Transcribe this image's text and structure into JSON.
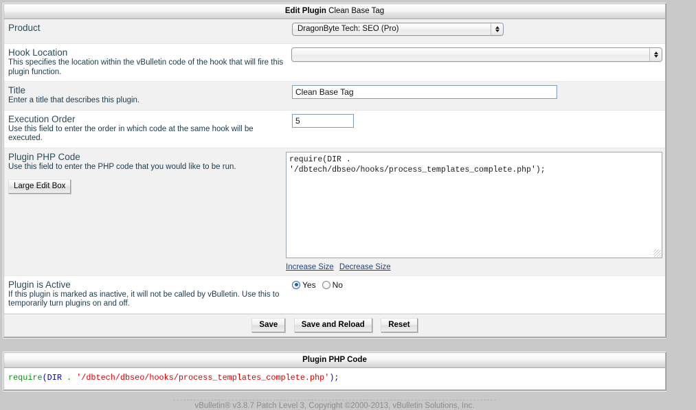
{
  "header": {
    "title_bold": "Edit Plugin",
    "title_sub": "Clean Base Tag"
  },
  "form": {
    "product": {
      "label": "Product",
      "value": "DragonByte Tech: SEO (Pro)"
    },
    "hook_location": {
      "label": "Hook Location",
      "description": "This specifies the location within the vBulletin code of the hook that will fire this plugin function.",
      "value": ""
    },
    "title": {
      "label": "Title",
      "description": "Enter a title that describes this plugin.",
      "value": "Clean Base Tag"
    },
    "execution_order": {
      "label": "Execution Order",
      "description": "Use this field to enter the order in which code at the same hook will be executed.",
      "value": "5"
    },
    "plugin_php_code": {
      "label": "Plugin PHP Code",
      "description": "Use this field to enter the PHP code that you would like to be run.",
      "large_edit_box_button": "Large Edit Box",
      "value": "require(DIR .\n'/dbtech/dbseo/hooks/process_templates_complete.php');",
      "increase_size_link": "Increase Size",
      "decrease_size_link": "Decrease Size"
    },
    "plugin_is_active": {
      "label": "Plugin is Active",
      "description": "If this plugin is marked as inactive, it will not be called by vBulletin. Use this to temporarily turn plugins on and off.",
      "yes_label": "Yes",
      "no_label": "No",
      "selected": "Yes"
    }
  },
  "buttons": {
    "save": "Save",
    "save_and_reload": "Save and Reload",
    "reset": "Reset"
  },
  "code_panel": {
    "title": "Plugin PHP Code",
    "tokens": [
      {
        "text": "require",
        "type": "kw"
      },
      {
        "text": "(",
        "type": "pun"
      },
      {
        "text": "DIR",
        "type": "id"
      },
      {
        "text": " ",
        "type": "plain"
      },
      {
        "text": ".",
        "type": "kw"
      },
      {
        "text": " ",
        "type": "plain"
      },
      {
        "text": "'/dbtech/dbseo/hooks/process_templates_complete.php'",
        "type": "str"
      },
      {
        "text": ");",
        "type": "pun"
      }
    ]
  },
  "footer": {
    "text": "vBulletin® v3.8.7 Patch Level 3, Copyright ©2000-2013, vBulletin Solutions, Inc."
  },
  "colors": {
    "page_background": "#c9c9c9",
    "row_alt": "#f1f1f1",
    "label_heading": "#2d4a55",
    "keyword": "#009900",
    "punctuation": "#0000bb",
    "string": "#dd0000",
    "link": "#22437a",
    "radio_selected": "#1f5fb0"
  }
}
